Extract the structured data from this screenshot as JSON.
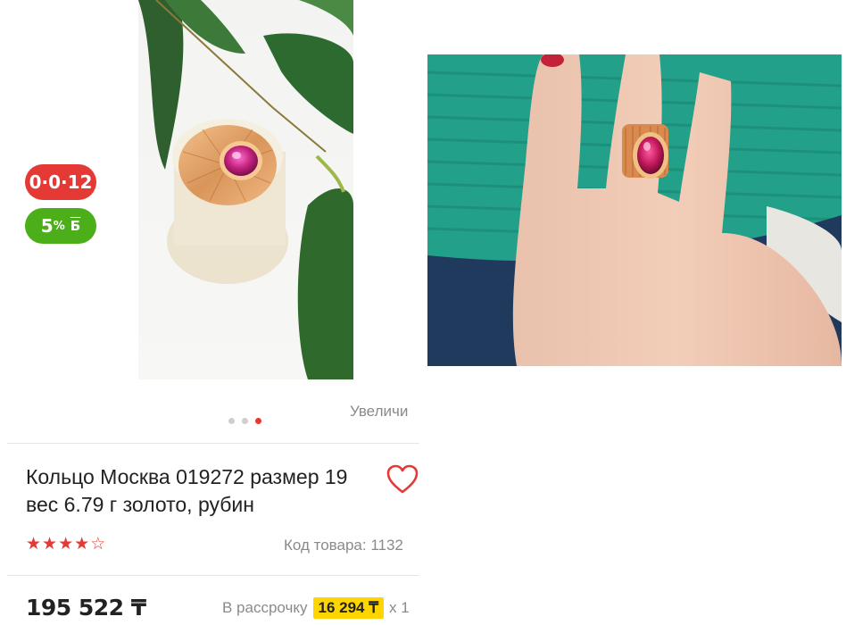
{
  "badges": {
    "installment": "0·0·12",
    "bonus_percent": "5",
    "bonus_unit": "%",
    "bonus_symbol": "Б"
  },
  "gallery": {
    "dots_count": 3,
    "active_dot": 3,
    "zoom_label": "Увеличи"
  },
  "product": {
    "title": "Кольцо Москва 019272 размер 19 вес 6.79 г золото, рубин",
    "rating": 4,
    "rating_max": 5,
    "sku_label": "Код товара: 1132",
    "price": "195 522 ₸",
    "installment_prefix": "В рассрочку",
    "installment_amount": "16 294 ₸",
    "installment_suffix": "x 1"
  },
  "colors": {
    "accent": "#e53935",
    "bonus": "#4caf1a",
    "highlight": "#ffd500"
  },
  "icons": {
    "favorite": "heart-icon",
    "star": "star-icon"
  }
}
